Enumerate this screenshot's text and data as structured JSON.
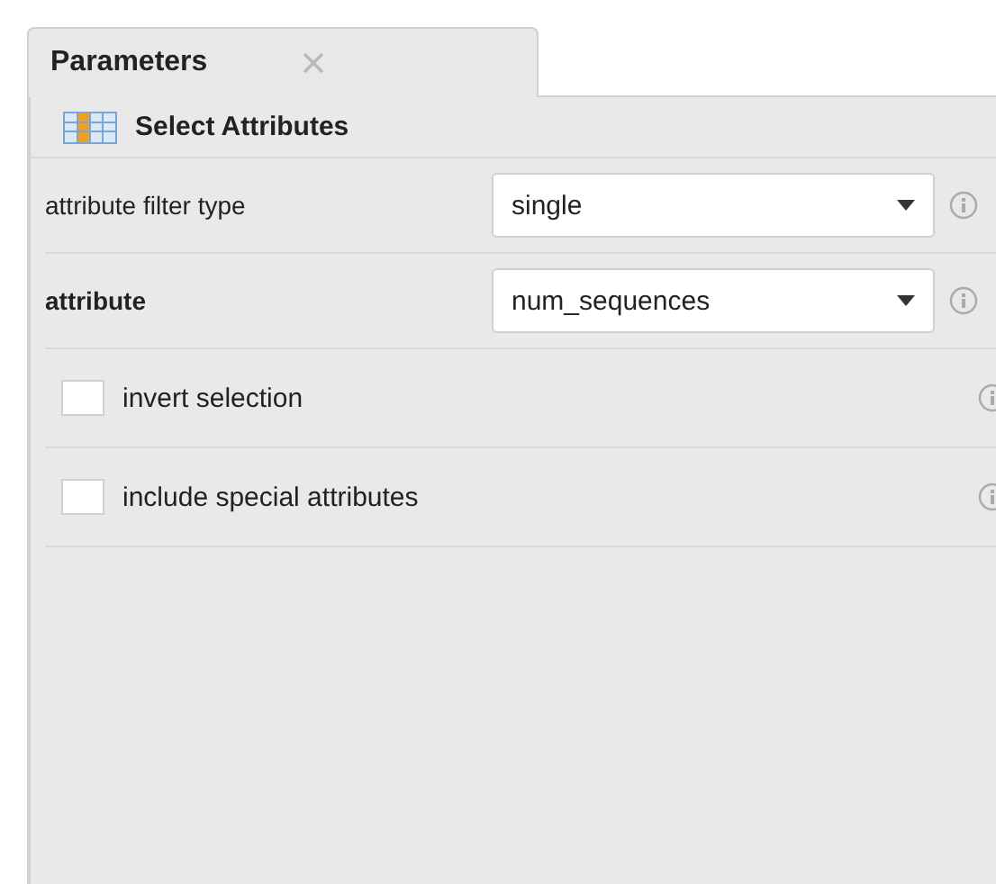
{
  "tabs": [
    {
      "label": "Parameters",
      "selected": true
    }
  ],
  "operator": {
    "title": "Select Attributes"
  },
  "parameters": [
    {
      "kind": "select",
      "label": "attribute filter type",
      "required": false,
      "value": "single"
    },
    {
      "kind": "select",
      "label": "attribute",
      "required": true,
      "value": "num_sequences"
    },
    {
      "kind": "checkbox",
      "label": "invert selection",
      "checked": false
    },
    {
      "kind": "checkbox",
      "label": "include special attributes",
      "checked": false
    }
  ]
}
